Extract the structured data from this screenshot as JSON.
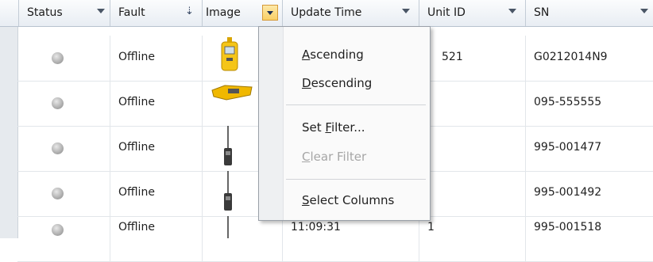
{
  "columns": [
    {
      "label": "Status"
    },
    {
      "label": "Fault"
    },
    {
      "label": "Image"
    },
    {
      "label": "Update Time"
    },
    {
      "label": "Unit ID"
    },
    {
      "label": "SN"
    }
  ],
  "rows": [
    {
      "fault": "Offline",
      "update_time": "",
      "unit_id": "521",
      "sn": "G0212014N9"
    },
    {
      "fault": "Offline",
      "update_time": "",
      "unit_id": "",
      "sn": "095-555555"
    },
    {
      "fault": "Offline",
      "update_time": "",
      "unit_id": "",
      "sn": "995-001477"
    },
    {
      "fault": "Offline",
      "update_time": "",
      "unit_id": "",
      "sn": "995-001492"
    },
    {
      "fault": "Offline",
      "update_time": "11:09:31",
      "unit_id": "1",
      "sn": "995-001518"
    }
  ],
  "menu": {
    "ascending": {
      "first": "A",
      "rest": "scending"
    },
    "descending": {
      "first": "D",
      "rest": "escending"
    },
    "set_filter": {
      "pre": "Set ",
      "first": "F",
      "rest": "ilter..."
    },
    "clear_filter": {
      "first": "C",
      "rest": "lear Filter"
    },
    "select_columns": {
      "first": "S",
      "rest": "elect Columns"
    }
  },
  "colors": {
    "header_bg": "#e8edf3",
    "active_filter_button": "#f9cf65",
    "status_dot": "#a9a9a9"
  },
  "icons": {
    "status": "gray-circle-icon",
    "filter": "dropdown-arrow-icon",
    "sort": "sort-descending-icon"
  }
}
